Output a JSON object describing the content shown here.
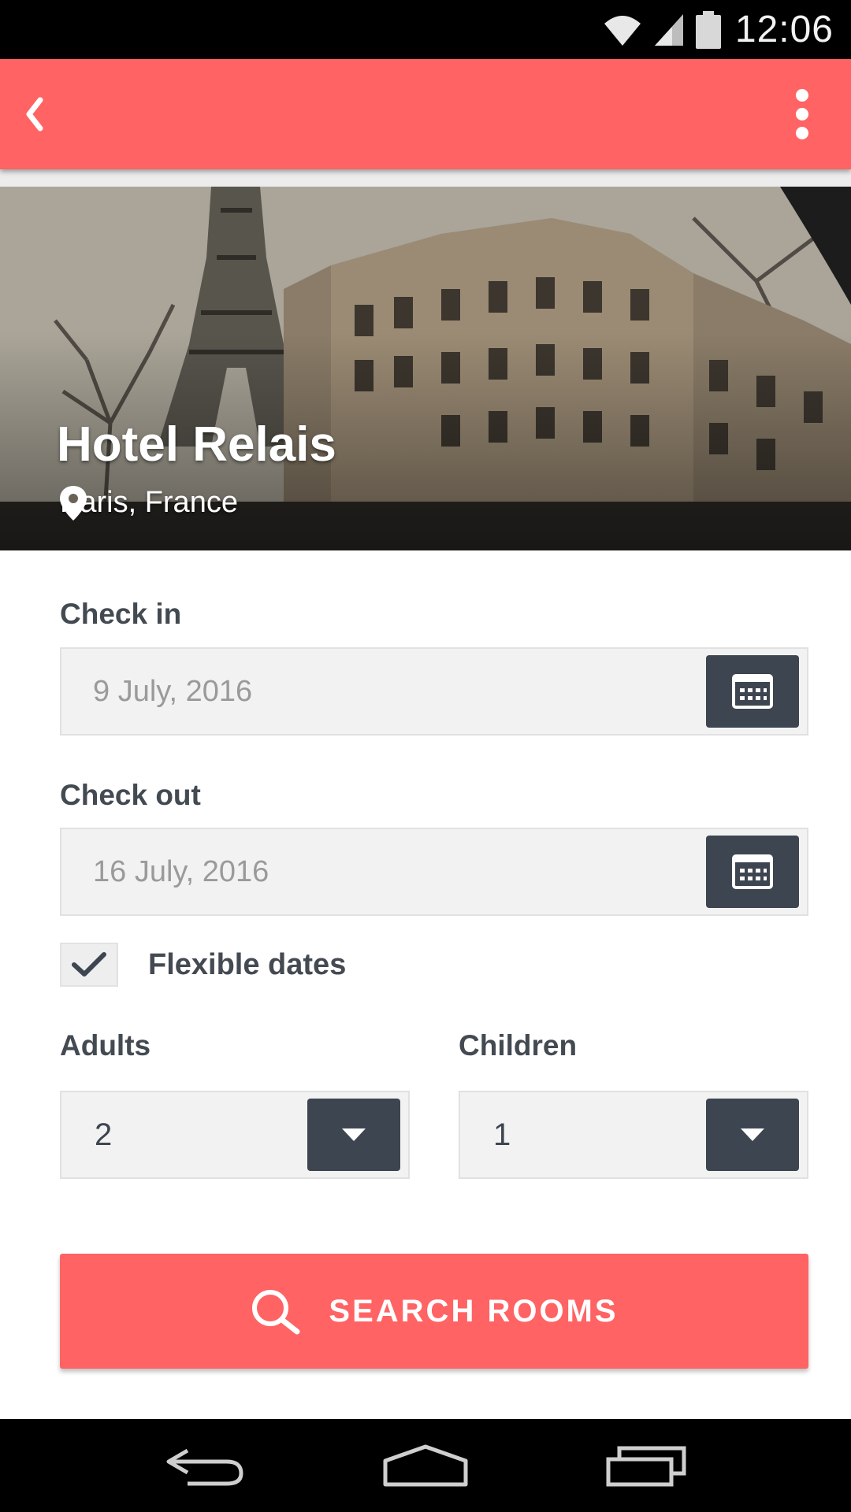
{
  "status_bar": {
    "time": "12:06",
    "icons": [
      "wifi-icon",
      "signal-icon",
      "battery-icon"
    ]
  },
  "app_bar": {
    "back_icon": "chevron-left-icon",
    "menu_icon": "overflow-menu-icon",
    "color": "#ff6363"
  },
  "hotel": {
    "name": "Hotel Relais",
    "location": "Paris, France",
    "location_icon": "map-pin-icon"
  },
  "form": {
    "check_in": {
      "label": "Check in",
      "value": "9 July, 2016",
      "icon": "calendar-icon"
    },
    "check_out": {
      "label": "Check out",
      "value": "16 July, 2016",
      "icon": "calendar-icon"
    },
    "flexible_dates": {
      "label": "Flexible dates",
      "checked": true
    },
    "adults": {
      "label": "Adults",
      "value": "2",
      "icon": "caret-down-icon"
    },
    "children": {
      "label": "Children",
      "value": "1",
      "icon": "caret-down-icon"
    },
    "search_button": {
      "label": "SEARCH ROOMS",
      "icon": "search-icon"
    }
  },
  "nav_bar": {
    "icons": [
      "back-nav-icon",
      "home-nav-icon",
      "recents-nav-icon"
    ]
  },
  "colors": {
    "accent": "#ff6363",
    "dark_button": "#3d4550",
    "field_bg": "#f2f2f2"
  }
}
